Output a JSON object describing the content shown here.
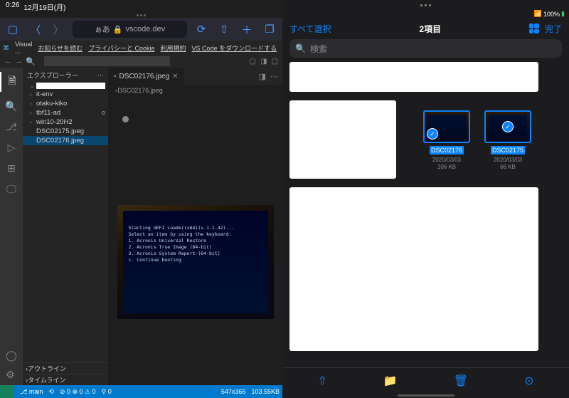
{
  "status": {
    "time": "0:26",
    "date": "12月19日(月)",
    "battery": "100%"
  },
  "safari": {
    "aa": "ぁあ",
    "domain": "vscode.dev"
  },
  "tabs": {
    "vs": "Visual ...",
    "links": [
      "お知らせを読む",
      "プライバシーと Cookie",
      "利用規約",
      "VS Code をダウンロードする"
    ]
  },
  "explorer": {
    "title": "エクスプローラー",
    "root": "",
    "items": [
      {
        "label": "it-env",
        "chev": "›"
      },
      {
        "label": "otaku-kiko",
        "chev": "›"
      },
      {
        "label": "tbf11-ad",
        "chev": "›",
        "dot": true
      },
      {
        "label": "win10-20H2",
        "chev": "›"
      },
      {
        "label": "DSC02175.jpeg",
        "chev": ""
      },
      {
        "label": "DSC02176.jpeg",
        "chev": "",
        "sel": true
      }
    ],
    "outline": "アウトライン",
    "timeline": "タイムライン"
  },
  "editor": {
    "tab": "DSC02176.jpeg",
    "bc": "DSC02176.jpeg",
    "photo_text": "Starting UEFI Loader(x64)(v.1.1.42)...\nSelect an item by using the keyboard:\n1. Acronis Universal Restore\n2. Acronis True Image (64-bit)\n3. Acronis System Report (64-bit)\nc. Continue booting"
  },
  "statusbar": {
    "branch": "main",
    "errs": "⊘ 0 ⊗ 0 ⚠ 0",
    "ports": "⚲ 0",
    "dim": "547x365",
    "size": "103.55KB"
  },
  "files": {
    "selectAll": "すべて選択",
    "count": "2項目",
    "done": "完了",
    "search": "検索",
    "items": [
      {
        "name": "DSC02176",
        "date": "2020/03/03",
        "size": "106 KB"
      },
      {
        "name": "DSC02175",
        "date": "2020/03/03",
        "size": "66 KB"
      }
    ]
  }
}
